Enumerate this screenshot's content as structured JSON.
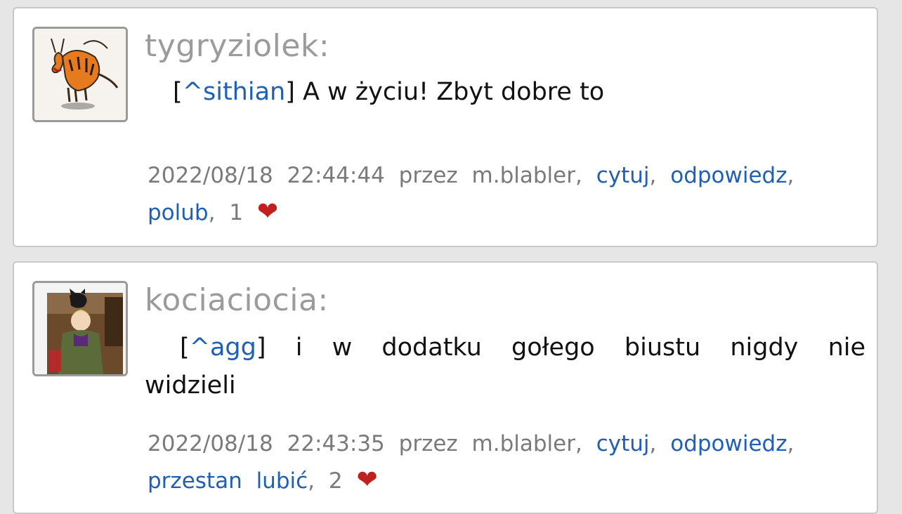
{
  "posts": [
    {
      "author": "tygryziolek:",
      "avatar_icon": "tiger-avatar-icon",
      "reply_to": "^sithian",
      "message": "A w życiu! Zbyt dobre to",
      "date": "2022/08/18",
      "time": "22:44:44",
      "via": "przez m.blabler,",
      "quote_label": "cytuj",
      "reply_label": "odpowiedz",
      "like_label": "polub",
      "likes": "1"
    },
    {
      "author": "kociaciocia:",
      "avatar_icon": "person-with-cat-avatar-icon",
      "reply_to": "^agg",
      "message": "i w dodatku gołego biustu nigdy nie widzieli",
      "date": "2022/08/18",
      "time": "22:43:35",
      "via": "przez m.blabler,",
      "quote_label": "cytuj",
      "reply_label": "odpowiedz",
      "like_label": "przestan lubić",
      "likes": "2"
    }
  ],
  "colors": {
    "link": "#1f5fb4",
    "author": "#9b9b9b",
    "heart": "#c0201e",
    "background": "#e6e6e6"
  }
}
